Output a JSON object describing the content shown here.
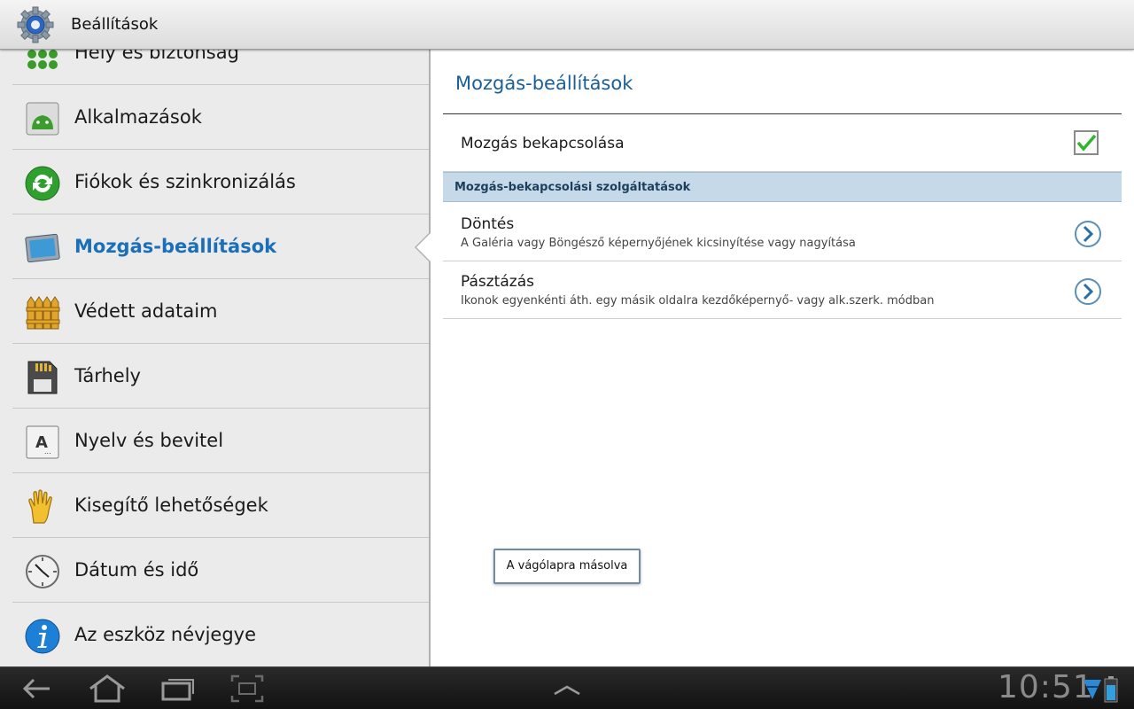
{
  "app": {
    "title": "Beállítások",
    "icon": "settings-gear-icon"
  },
  "sidebar": {
    "items": [
      {
        "label": "Hely és biztonság",
        "icon": "location-security-icon",
        "selected": false
      },
      {
        "label": "Alkalmazások",
        "icon": "applications-icon",
        "selected": false
      },
      {
        "label": "Fiókok és szinkronizálás",
        "icon": "sync-icon",
        "selected": false
      },
      {
        "label": "Mozgás-beállítások",
        "icon": "motion-icon",
        "selected": true
      },
      {
        "label": "Védett adataim",
        "icon": "fence-icon",
        "selected": false
      },
      {
        "label": "Tárhely",
        "icon": "storage-icon",
        "selected": false
      },
      {
        "label": "Nyelv és bevitel",
        "icon": "language-input-icon",
        "selected": false
      },
      {
        "label": "Kisegítő lehetőségek",
        "icon": "hand-icon",
        "selected": false
      },
      {
        "label": "Dátum és idő",
        "icon": "clock-icon",
        "selected": false
      },
      {
        "label": "Az eszköz névjegye",
        "icon": "info-icon",
        "selected": false
      }
    ]
  },
  "main": {
    "title": "Mozgás-beállítások",
    "motion_toggle": {
      "label": "Mozgás bekapcsolása",
      "checked": true
    },
    "category": "Mozgás-bekapcsolási szolgáltatások",
    "prefs": [
      {
        "title": "Döntés",
        "summary": "A Galéria vagy Böngésző képernyőjének kicsinyítése vagy nagyítása",
        "icon": "chevron-right-icon"
      },
      {
        "title": "Pásztázás",
        "summary": "Ikonok egyenkénti áth. egy másik oldalra kezdőképernyő- vagy alk.szerk. módban",
        "icon": "chevron-right-icon"
      }
    ]
  },
  "toast": {
    "text": "A vágólapra másolva"
  },
  "systembar": {
    "clock": "10:51",
    "buttons": [
      "back-icon",
      "home-icon",
      "recent-apps-icon",
      "screenshot-icon",
      "menu-up-icon"
    ],
    "status_icons": [
      "wifi-icon",
      "battery-icon"
    ]
  },
  "colors": {
    "accent": "#1a6fb8",
    "title_blue": "#1a5f99",
    "category_bg": "#c5d9e8",
    "check_green": "#2fb52f"
  }
}
